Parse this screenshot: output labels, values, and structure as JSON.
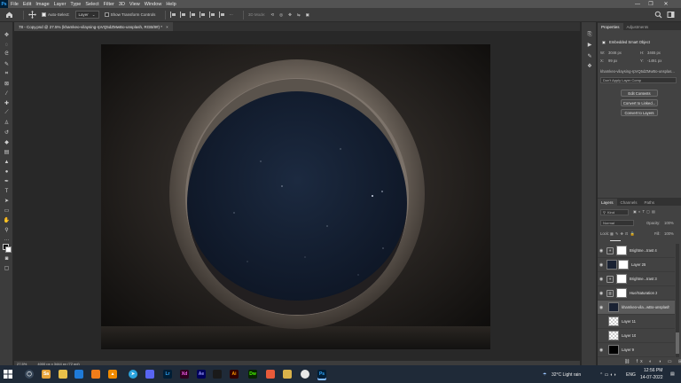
{
  "menubar": {
    "logo": "Ps",
    "items": [
      "File",
      "Edit",
      "Image",
      "Layer",
      "Type",
      "Select",
      "Filter",
      "3D",
      "View",
      "Window",
      "Help"
    ],
    "controls": [
      "—",
      "❐",
      "✕"
    ]
  },
  "options": {
    "auto_select_label": "Auto-Select:",
    "auto_select_value": "Layer",
    "show_transform": "Show Transform Controls",
    "mode_3d": "3D Mode:"
  },
  "document": {
    "tab_title": "78 - Copy.psd @ 27.5% (khamkeo-vilaysing-rpVQ5dZMwBo-unsplash, RGB/8#) *",
    "close": "×",
    "zoom": "27.5%",
    "doc_size": "4000 px x 3444 px (72 ppi)"
  },
  "properties": {
    "tabs": [
      "Properties",
      "Adjustments"
    ],
    "type_label": "Embedded Smart Object",
    "w_label": "W:",
    "w_value": "3046 px",
    "h_label": "H:",
    "h_value": "3465 px",
    "x_label": "X:",
    "x_value": "99 px",
    "y_label": "Y:",
    "y_value": "-1491 px",
    "filename": "khamkeo-vilaysing-rpVQ5dZMwBo-unsplas...",
    "comp_placeholder": "Don't Apply Layer Comp",
    "buttons": [
      "Edit Contents",
      "Convert to Linked...",
      "Convert to Layers"
    ]
  },
  "layers_panel": {
    "tabs": [
      "Layers",
      "Channels",
      "Paths"
    ],
    "kind": "Kind",
    "blend_mode": "Normal",
    "opacity_label": "Opacity:",
    "opacity_value": "100%",
    "lock_label": "Lock:",
    "fill_label": "Fill:",
    "fill_value": "100%",
    "layers": [
      {
        "name": "Brightne...trast 4",
        "type": "adjust",
        "visible": true
      },
      {
        "name": "Layer 25",
        "type": "photo",
        "visible": true
      },
      {
        "name": "Brightne...trast 3",
        "type": "adjust",
        "visible": true
      },
      {
        "name": "Hue/Saturation 2",
        "type": "hue",
        "visible": true
      },
      {
        "name": "khamkeo-vila...wBo-unsplash",
        "type": "smart",
        "visible": true,
        "selected": true
      },
      {
        "name": "Layer 11",
        "type": "checker",
        "visible": false
      },
      {
        "name": "Layer 10",
        "type": "checker",
        "visible": false
      },
      {
        "name": "Layer 9",
        "type": "dark",
        "visible": true
      }
    ]
  },
  "taskbar": {
    "apps": [
      "Sa",
      "File",
      "Edge",
      "VLC",
      "Tg",
      "Dsc",
      "Lr",
      "Ae",
      "Ai",
      "Dw",
      "Ps",
      "Wa",
      "Ch",
      "Ps"
    ],
    "weather": "32°C  Light rain",
    "lang": "ENG",
    "time": "12:56 PM",
    "date": "14-07-2022"
  },
  "colors": {
    "accent": "#31a8ff",
    "panel": "#424242",
    "workspace": "#282828"
  }
}
